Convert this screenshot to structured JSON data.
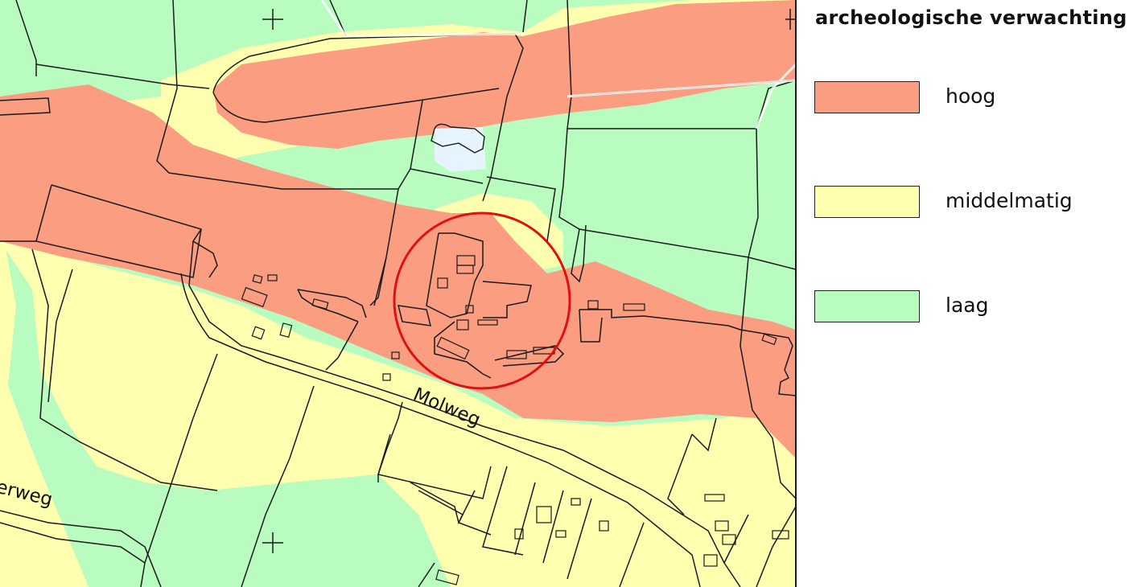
{
  "map": {
    "road_labels": {
      "molweg": "Molweg",
      "other_road": "erweg"
    },
    "colors": {
      "background": "#b8fcbf",
      "parcel_lines": "#1a1a1a",
      "marker_circle": "#e01010",
      "water": "#e6f4ff"
    }
  },
  "legend": {
    "title": "archeologische verwachting",
    "items": [
      {
        "label": "hoog",
        "color": "#fb9d80"
      },
      {
        "label": "middelmatig",
        "color": "#ffffb0"
      },
      {
        "label": "laag",
        "color": "#b8fcbf"
      }
    ]
  }
}
